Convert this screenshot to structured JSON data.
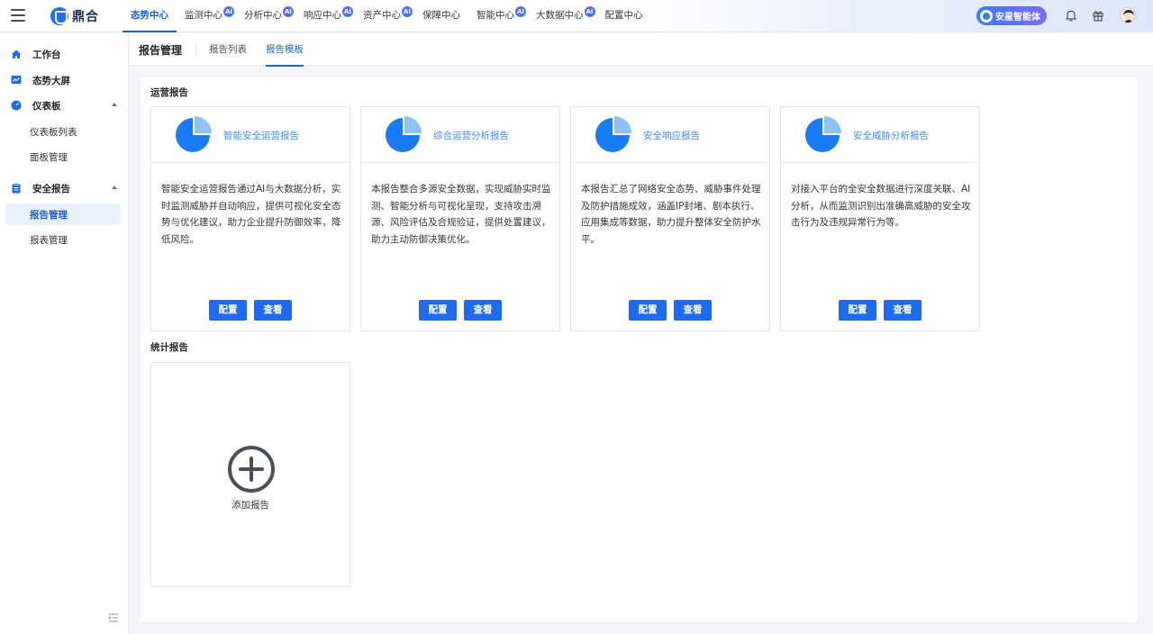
{
  "topbar": {
    "logo_text": "鼎合",
    "nav": [
      {
        "label": "态势中心",
        "ai": false
      },
      {
        "label": "监测中心",
        "ai": true
      },
      {
        "label": "分析中心",
        "ai": true
      },
      {
        "label": "响应中心",
        "ai": true
      },
      {
        "label": "资产中心",
        "ai": true
      },
      {
        "label": "保障中心",
        "ai": false
      },
      {
        "label": "智能中心",
        "ai": true
      },
      {
        "label": "大数据中心",
        "ai": true
      },
      {
        "label": "配置中心",
        "ai": false
      }
    ],
    "ai_badge": "AI",
    "agent_button": "安星智能体"
  },
  "sidebar": {
    "items": [
      {
        "label": "工作台"
      },
      {
        "label": "态势大屏"
      },
      {
        "label": "仪表板"
      },
      {
        "label": "仪表板列表"
      },
      {
        "label": "面板管理"
      },
      {
        "label": "安全报告"
      },
      {
        "label": "报告管理"
      },
      {
        "label": "报表管理"
      }
    ]
  },
  "subheader": {
    "title": "报告管理",
    "tabs": [
      {
        "label": "报告列表"
      },
      {
        "label": "报告模板"
      }
    ]
  },
  "main": {
    "ops_section_title": "运营报告",
    "stats_section_title": "统计报告",
    "config_label": "配置",
    "view_label": "查看",
    "cards": [
      {
        "name": "智能安全运营报告",
        "desc": "智能安全运营报告通过AI与大数据分析，实时监测威胁并自动响应，提供可视化安全态势与优化建议，助力企业提升防御效率，降低风险。"
      },
      {
        "name": "综合运营分析报告",
        "desc": "本报告整合多源安全数据，实现威胁实时监测、智能分析与可视化呈现，支持攻击溯源、风险评估及合规验证，提供处置建议，助力主动防御决策优化。"
      },
      {
        "name": "安全响应报告",
        "desc": "本报告汇总了网络安全态势、威胁事件处理及防护措施成效，涵盖IP封堵、剧本执行、应用集成等数据，助力提升整体安全防护水平。"
      },
      {
        "name": "安全威胁分析报告",
        "desc": "对接入平台的全安全数据进行深度关联、AI分析，从而监测识别出准确高威胁的安全攻击行为及违规异常行为等。"
      }
    ],
    "add_report_label": "添加报告"
  },
  "colors": {
    "accent": "#1f6bf0",
    "pie_main": "#1a7cf5",
    "pie_slice": "#8fc3f7",
    "card_title": "#3f8cf0"
  }
}
